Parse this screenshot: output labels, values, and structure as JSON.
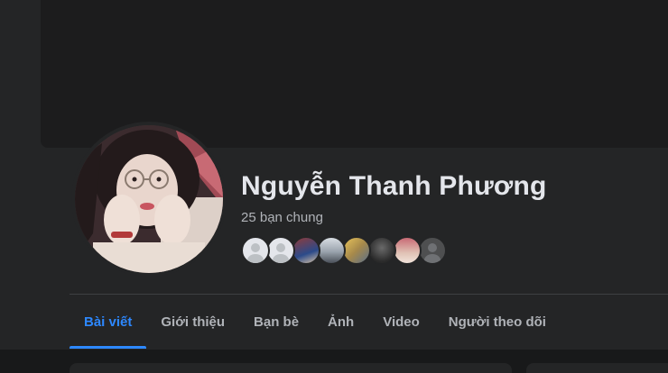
{
  "profile": {
    "name": "Nguyễn Thanh Phương",
    "mutual_friends": "25 bạn chung"
  },
  "tabs": [
    {
      "label": "Bài viết",
      "active": true
    },
    {
      "label": "Giới thiệu",
      "active": false
    },
    {
      "label": "Bạn bè",
      "active": false
    },
    {
      "label": "Ảnh",
      "active": false
    },
    {
      "label": "Video",
      "active": false
    },
    {
      "label": "Người theo dõi",
      "active": false
    }
  ],
  "colors": {
    "accent": "#2d88ff",
    "background": "#18191a",
    "surface": "#242526",
    "text_primary": "#e4e6eb",
    "text_secondary": "#b0b3b8"
  }
}
